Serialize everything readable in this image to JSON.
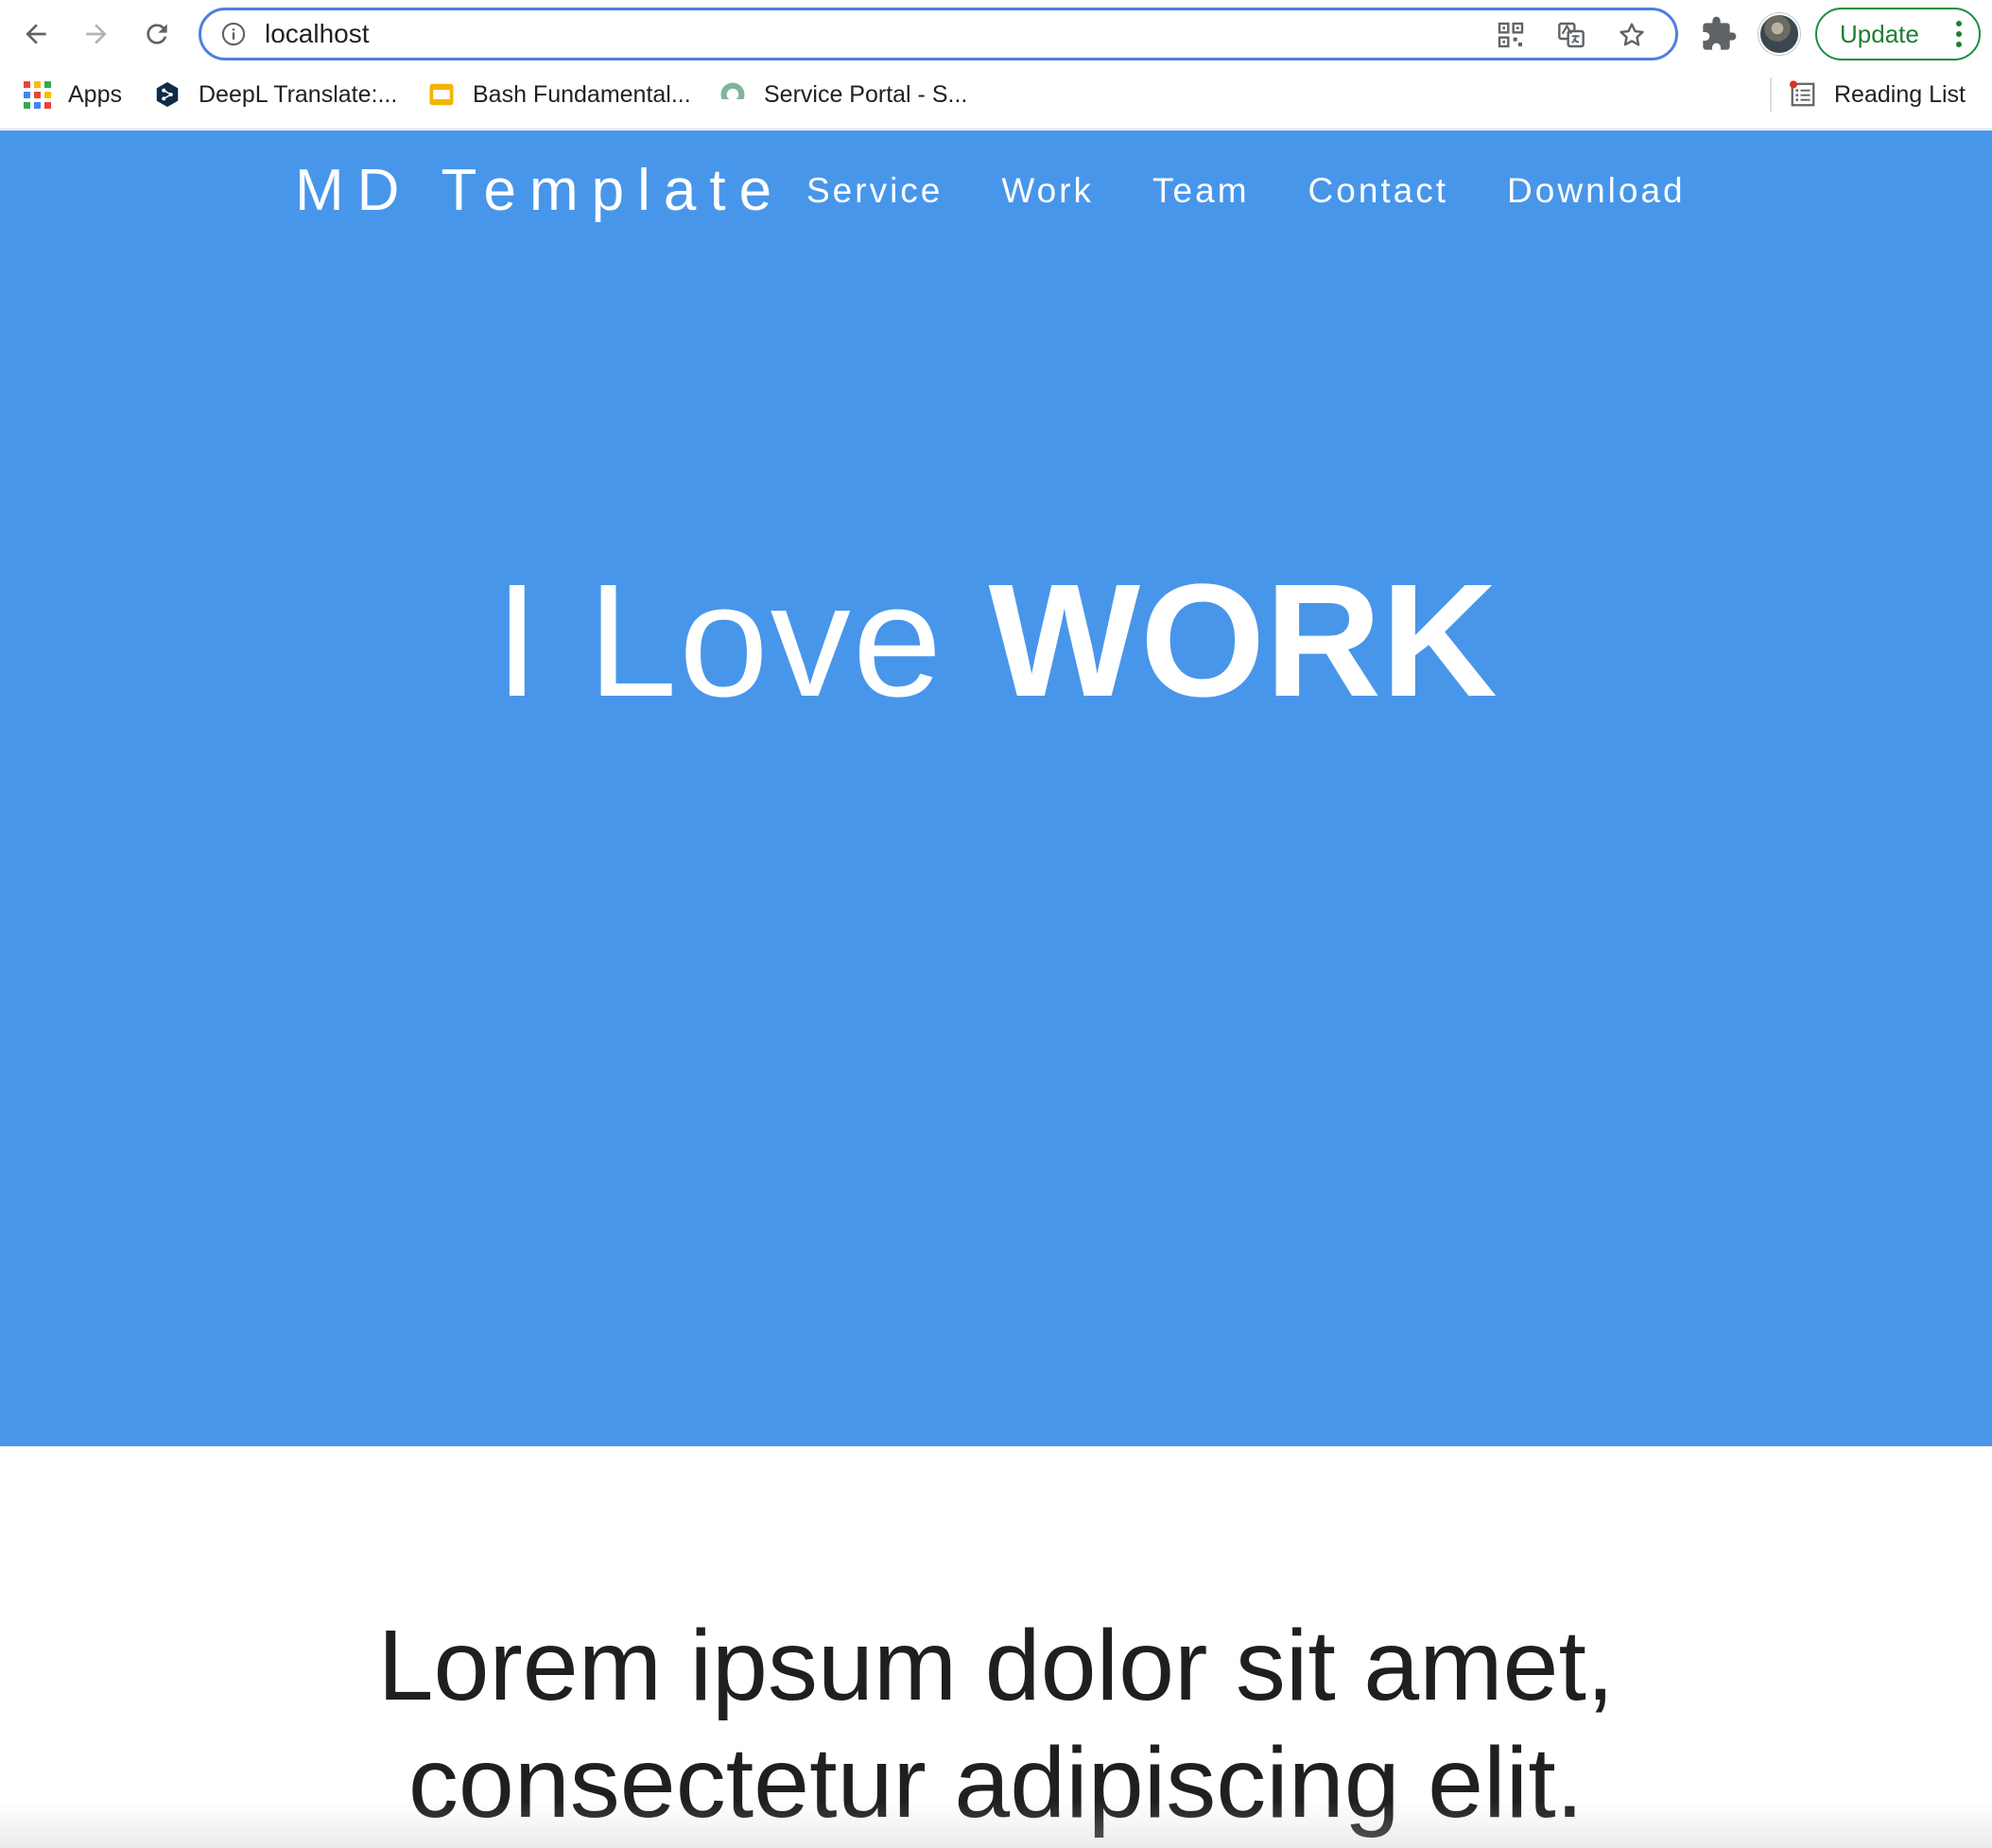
{
  "browser": {
    "url": "localhost",
    "update_label": "Update",
    "bookmarks": [
      {
        "label": "Apps",
        "icon": "apps-grid-icon"
      },
      {
        "label": "DeepL Translate:...",
        "icon": "deepl-icon"
      },
      {
        "label": "Bash Fundamental...",
        "icon": "slides-icon"
      },
      {
        "label": "Service Portal - S...",
        "icon": "service-portal-icon"
      }
    ],
    "reading_list_label": "Reading List"
  },
  "page": {
    "brand": "MD Template",
    "nav": [
      {
        "label": "Service"
      },
      {
        "label": "Work"
      },
      {
        "label": "Team"
      },
      {
        "label": "Contact"
      },
      {
        "label": "Download"
      }
    ],
    "hero": {
      "headline_light": "I Love",
      "headline_bold": "WORK"
    },
    "intro": {
      "line1": "Lorem ipsum dolor sit amet,",
      "line2": "consectetur adipiscing elit."
    }
  },
  "colors": {
    "hero_bg": "#4896ea",
    "omnibox_border": "#4f7fe0",
    "update_green": "#1e7e34"
  }
}
